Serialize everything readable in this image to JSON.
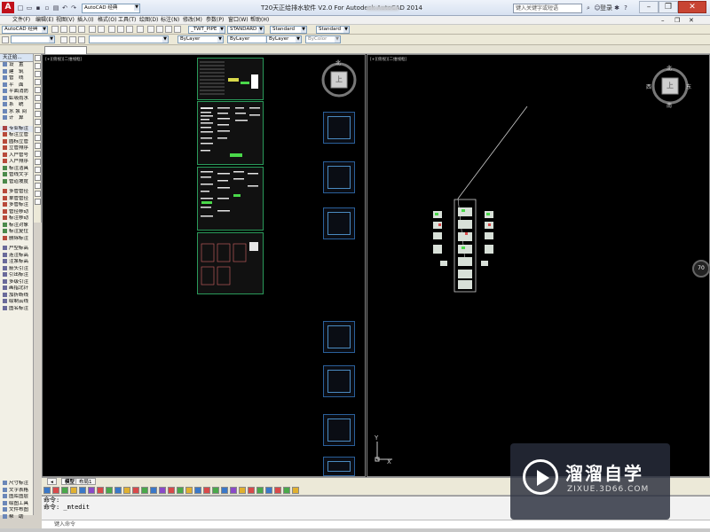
{
  "window": {
    "title": "T20天正给排水软件 V2.0 For Autodesk AutoCAD 2014",
    "app_icon": "A",
    "workspace": "AutoCAD 经典",
    "search_placeholder": "键入关键字或短语",
    "login": "登录",
    "minimize": "–",
    "restore": "❐",
    "close": "✕"
  },
  "menu": {
    "items": [
      "文件(F)",
      "编辑(E)",
      "视图(V)",
      "插入(I)",
      "格式(O)",
      "工具(T)",
      "绘图(D)",
      "标注(N)",
      "修改(M)",
      "参数(P)",
      "窗口(W)",
      "帮助(H)"
    ]
  },
  "toolbar2": {
    "workspace": "AutoCAD 经典",
    "pipe_style": "_TWT_PIPE",
    "text_style": "STANDARD",
    "dim_style": "Standard",
    "table_style": "Standard"
  },
  "toolbar3": {
    "color": "ByLayer",
    "linetype": "ByLayer",
    "lineweight": "ByLayer",
    "plotstyle": "ByColor"
  },
  "doc_tab": "",
  "left_panel": {
    "title": "天正给...",
    "groups": [
      [
        "设　置",
        "建　筑",
        "管　线",
        "平　面",
        "平面消防",
        "虹吸雨水",
        "系　统",
        "水 泵 间",
        "计　算"
      ],
      [
        "专业标注"
      ],
      [
        "标注立管",
        "圆标立管",
        "立管排序",
        "入户管号",
        "入户排序",
        "标注洁具",
        "管线文字",
        "管道坡度"
      ],
      [
        "多管管径",
        "单管管径",
        "多管标注",
        "管径移动",
        "标注移动",
        "标注对象",
        "标注复位",
        "删除标注"
      ],
      [
        "户型标高",
        "连注标高",
        "注泵标高",
        "箭头引注",
        "引出标注",
        "多级引注",
        "画指北针",
        "加折断线",
        "绘制云线",
        "图名标注"
      ],
      [
        "尺寸标注",
        "文字表格",
        "图库图层",
        "绘图工具",
        "文件布图",
        "帮　助"
      ]
    ]
  },
  "canvas": {
    "left_viewport_label": "[+][俯视][二维线框]",
    "right_viewport_label": "[+][俯视][二维线框]",
    "compass_north": "北",
    "compass_south": "南",
    "compass_east": "东",
    "compass_west": "西",
    "compass_top": "上",
    "axis_x": "X",
    "axis_y": "Y",
    "zoom": "70"
  },
  "layout_tabs": [
    "模型",
    "布局1"
  ],
  "command": {
    "line1": "命令:",
    "line2": "命令: _mtedit",
    "input_placeholder": "键入命令"
  },
  "watermark": {
    "title": "溜溜自学",
    "url": "ZIXUE.3D66.COM"
  }
}
